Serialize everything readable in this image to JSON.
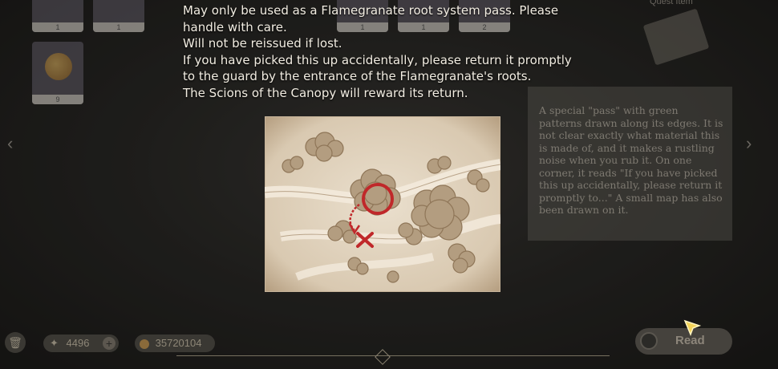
{
  "note": {
    "lines": [
      "May only be used as a Flamegranate root system pass. Please",
      "handle with care.",
      "Will not be reissued if lost.",
      "If you have picked this up accidentally, please return it promptly",
      "to the guard by the entrance of the Flamegranate's roots.",
      "The Scions of the Canopy will reward its return."
    ]
  },
  "inventory": {
    "counts": [
      "1",
      "1",
      "1",
      "1",
      "2",
      "9"
    ]
  },
  "detail": {
    "category": "Quest Item",
    "description": "A special \"pass\" with green patterns drawn along its edges. It is not clear exactly what material this is made of, and it makes a rustling noise when you rub it. On one corner, it reads \"If you have picked this up accidentally, please return it promptly to...\" A small map has also been drawn on it."
  },
  "currency": {
    "primogems": "4496",
    "mora": "35720104"
  },
  "actions": {
    "read_label": "Read"
  },
  "colors": {
    "map_paper": "#e2d6c4",
    "map_marker": "#c0282a"
  }
}
